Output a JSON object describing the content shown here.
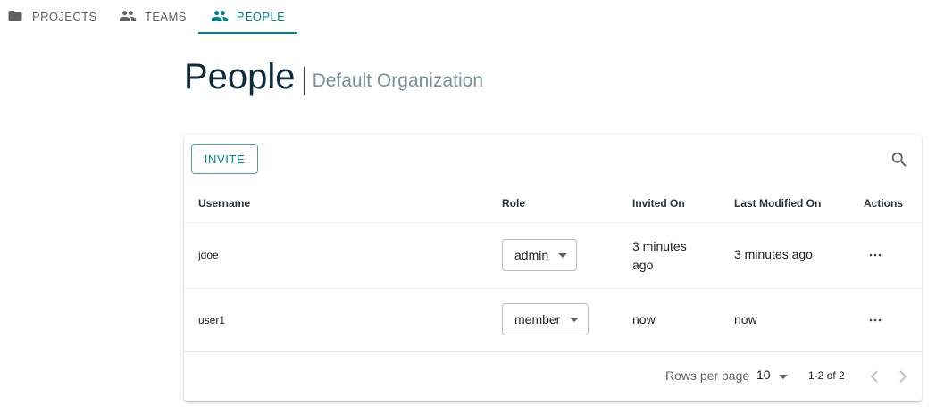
{
  "tabs": [
    {
      "label": "PROJECTS",
      "icon": "folder-icon"
    },
    {
      "label": "TEAMS",
      "icon": "people-icon"
    },
    {
      "label": "PEOPLE",
      "icon": "people-icon",
      "active": true
    }
  ],
  "header": {
    "title": "People",
    "subtitle": "Default Organization"
  },
  "toolbar": {
    "invite_label": "INVITE",
    "search_icon": "search-icon"
  },
  "table": {
    "columns": [
      "Username",
      "Role",
      "Invited On",
      "Last Modified On",
      "Actions"
    ],
    "rows": [
      {
        "username": "jdoe",
        "role": "admin",
        "invited_on": "3 minutes ago",
        "last_modified": "3 minutes ago",
        "actions_icon": "more-horizontal-icon"
      },
      {
        "username": "user1",
        "role": "member",
        "invited_on": "now",
        "last_modified": "now",
        "actions_icon": "more-horizontal-icon"
      }
    ]
  },
  "pagination": {
    "rows_per_page_label": "Rows per page",
    "rows_per_page": "10",
    "range": "1-2 of 2"
  },
  "colors": {
    "accent": "#00838f",
    "title": "#0d2b3e",
    "subtitle": "#78909c"
  }
}
